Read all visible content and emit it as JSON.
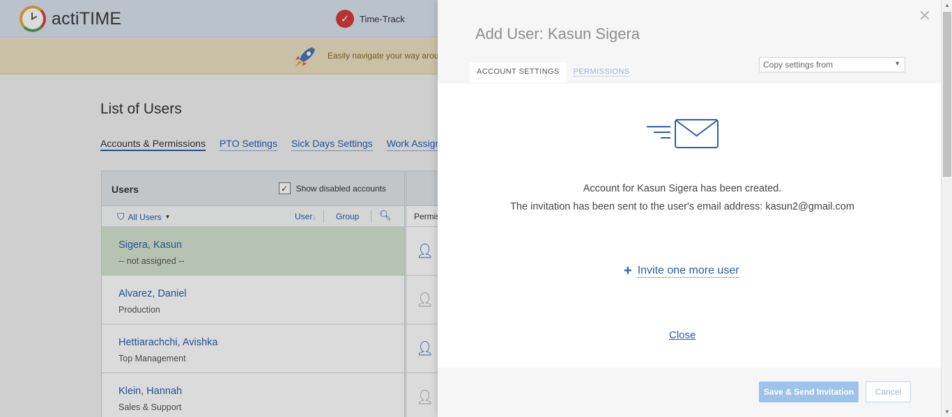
{
  "app": {
    "logo_text": "actiTIME"
  },
  "topnav": {
    "time_track_label": "Time-Track"
  },
  "banner": {
    "text": "Easily navigate your way arou"
  },
  "page": {
    "title": "List of Users",
    "subnav": [
      "Accounts & Permissions",
      "PTO Settings",
      "Sick Days Settings",
      "Work Assign"
    ]
  },
  "users_panel": {
    "title": "Users",
    "show_disabled_label": "Show disabled accounts",
    "filter_label": "All Users",
    "sort_label": "User",
    "group_label": "Group",
    "perm_header_label": "Permis",
    "rows": [
      {
        "name": "Sigera, Kasun",
        "group": "-- not assigned --"
      },
      {
        "name": "Alvarez, Daniel",
        "group": "Production"
      },
      {
        "name": "Hettiarachchi, Avishka",
        "group": "Top Management"
      },
      {
        "name": "Klein, Hannah",
        "group": "Sales & Support"
      }
    ]
  },
  "modal": {
    "title": "Add User: Kasun Sigera",
    "tabs": {
      "account": "ACCOUNT SETTINGS",
      "permissions": "PERMISSIONS"
    },
    "copy_settings_placeholder": "Copy settings from",
    "message_line1": "Account for Kasun Sigera has been created.",
    "message_line2": "The invitation has been sent to the user's email address: kasun2@gmail.com",
    "invite_more": "Invite one more user",
    "close_link": "Close",
    "save_button": "Save & Send Invitation",
    "cancel_button": "Cancel"
  },
  "colors": {
    "accent": "#2a5ea8",
    "selected_row": "#d6e4d0",
    "save_button": "#9ec3ea"
  }
}
